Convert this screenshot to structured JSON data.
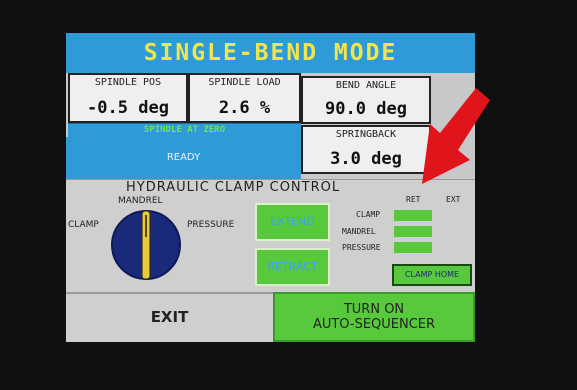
{
  "title": "SINGLE-BEND MODE",
  "spindle_pos": {
    "label": "SPINDLE POS",
    "value": "-0.5 deg"
  },
  "spindle_load": {
    "label": "SPINDLE LOAD",
    "value": "2.6 %"
  },
  "bend_angle": {
    "label": "BEND ANGLE",
    "value": "90.0 deg"
  },
  "springback": {
    "label": "SPRINGBACK",
    "value": "3.0 deg"
  },
  "spindle_status": "SPINDLE AT ZERO",
  "status": "READY",
  "clamp_panel": {
    "title": "HYDRAULIC CLAMP CONTROL",
    "dial_labels": {
      "mandrel": "MANDREL",
      "clamp": "CLAMP",
      "pressure": "PRESSURE"
    },
    "extend_label": "EXTEND",
    "retract_label": "RETRACT",
    "ret_label": "RET",
    "ext_label": "EXT",
    "indicators": [
      "CLAMP",
      "MANDREL",
      "PRESSURE"
    ],
    "clamp_home_label": "CLAMP HOME"
  },
  "exit_label": "EXIT",
  "auto_sequencer": {
    "line1": "TURN ON",
    "line2": "AUTO-SEQUENCER"
  },
  "colors": {
    "accent_blue": "#2e9ad6",
    "title_yellow": "#f1e54e",
    "green": "#58c83c",
    "dial_navy": "#1a2a7a",
    "dial_yellow": "#e7c93b",
    "arrow_red": "#e0141b"
  }
}
